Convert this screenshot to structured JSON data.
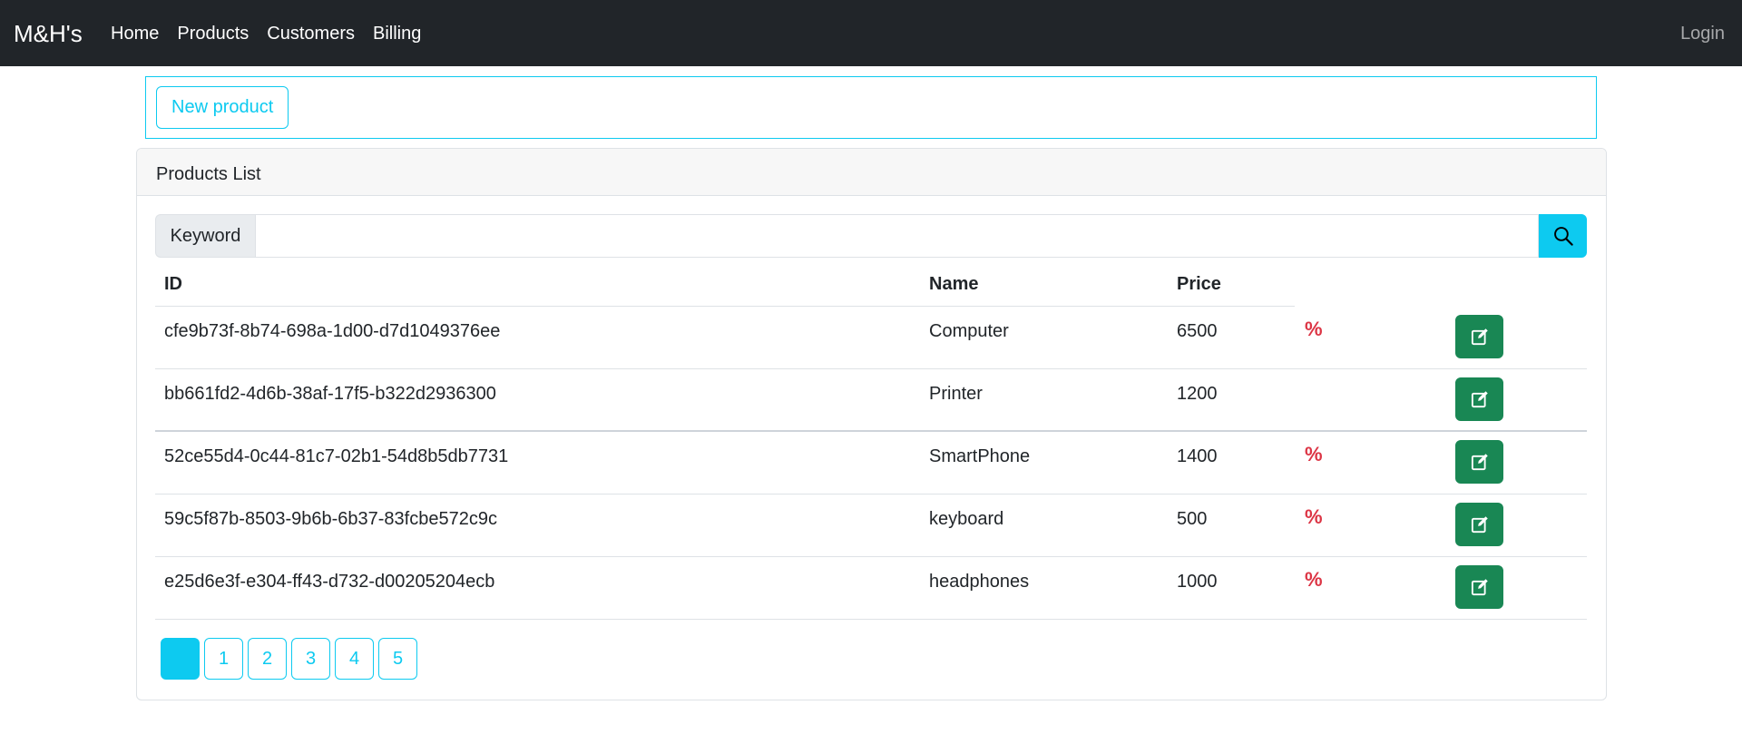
{
  "navbar": {
    "brand": "M&H's",
    "links": [
      "Home",
      "Products",
      "Customers",
      "Billing"
    ],
    "login": "Login"
  },
  "toolbar": {
    "new_product_label": "New product"
  },
  "card": {
    "title": "Products List"
  },
  "search": {
    "label": "Keyword",
    "value": "",
    "icon": "search-icon"
  },
  "table": {
    "headers": [
      "ID",
      "Name",
      "Price"
    ],
    "rows": [
      {
        "id": "cfe9b73f-8b74-698a-1d00-d7d1049376ee",
        "name": "Computer",
        "price": "6500",
        "discount": "%"
      },
      {
        "id": "bb661fd2-4d6b-38af-17f5-b322d2936300",
        "name": "Printer",
        "price": "1200",
        "discount": ""
      },
      {
        "id": "52ce55d4-0c44-81c7-02b1-54d8b5db7731",
        "name": "SmartPhone",
        "price": "1400",
        "discount": "%"
      },
      {
        "id": "59c5f87b-8503-9b6b-6b37-83fcbe572c9c",
        "name": "keyboard",
        "price": "500",
        "discount": "%"
      },
      {
        "id": "e25d6e3f-e304-ff43-d732-d00205204ecb",
        "name": "headphones",
        "price": "1000",
        "discount": "%"
      }
    ],
    "edit_icon": "edit-icon"
  },
  "pagination": {
    "pages": [
      "",
      "1",
      "2",
      "3",
      "4",
      "5"
    ],
    "active_index": 0
  },
  "colors": {
    "navbar_bg": "#212529",
    "info": "#0dcaf0",
    "success": "#198754",
    "danger": "#dc3545"
  }
}
